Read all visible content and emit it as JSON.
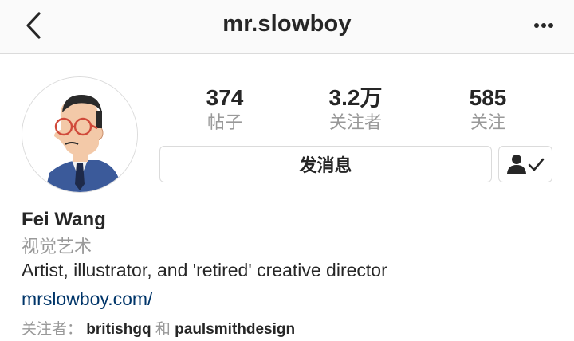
{
  "navbar": {
    "title": "mr.slowboy",
    "back_icon": "chevron-left-icon",
    "more_icon": "more-horizontal-icon"
  },
  "stats": [
    {
      "value": "374",
      "label": "帖子"
    },
    {
      "value": "3.2万",
      "label": "关注者"
    },
    {
      "value": "585",
      "label": "关注"
    }
  ],
  "actions": {
    "message_label": "发消息",
    "following_icon": "person-check-icon"
  },
  "profile": {
    "name": "Fei Wang",
    "category": "视觉艺术",
    "bio": "Artist, illustrator, and 'retired' creative director",
    "link": "mrslowboy.com/"
  },
  "followed_by": {
    "prefix": "关注者：",
    "accounts": [
      "britishgq",
      "paulsmithdesign"
    ],
    "joiner": "和"
  },
  "colors": {
    "text": "#262626",
    "muted": "#999999",
    "link": "#003569",
    "border": "#dbdbdb"
  }
}
